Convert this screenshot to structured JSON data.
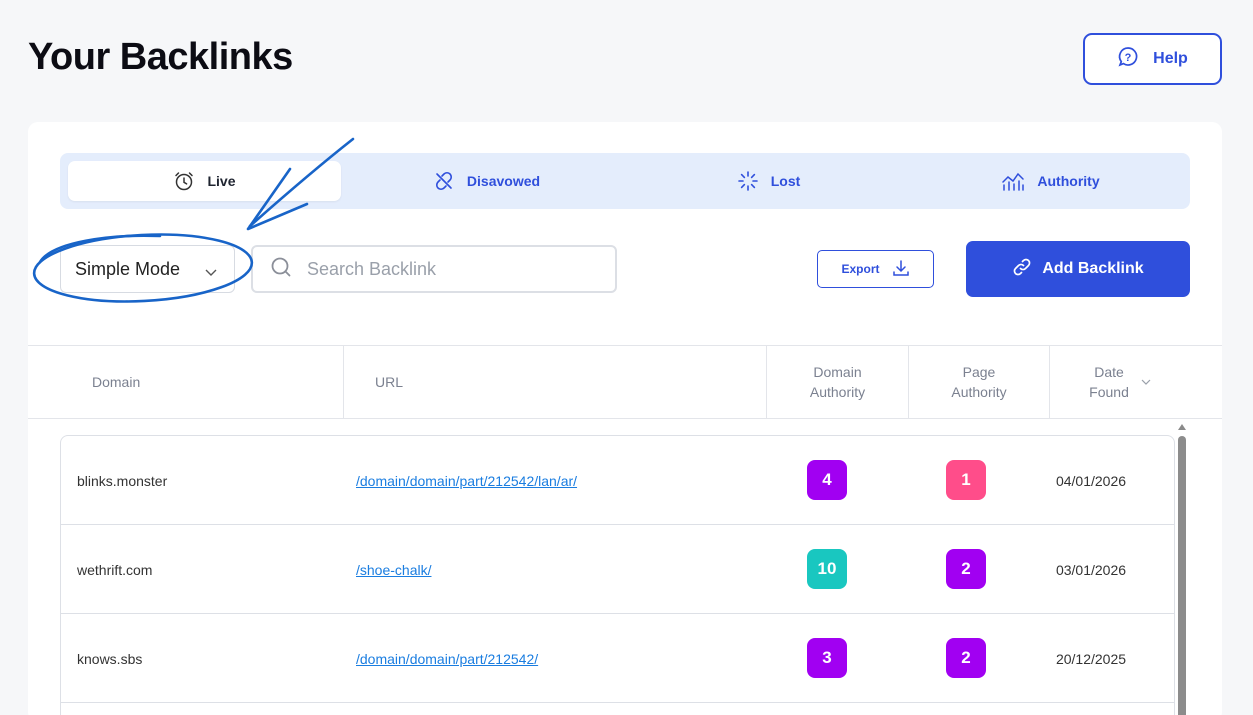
{
  "header": {
    "title": "Your Backlinks",
    "help_label": "Help"
  },
  "tabs": [
    {
      "label": "Live",
      "icon": "alarm-clock-icon",
      "active": true
    },
    {
      "label": "Disavowed",
      "icon": "broken-link-icon",
      "active": false
    },
    {
      "label": "Lost",
      "icon": "loading-spinner-icon",
      "active": false
    },
    {
      "label": "Authority",
      "icon": "chart-line-icon",
      "active": false
    }
  ],
  "toolbar": {
    "mode_value": "Simple Mode",
    "search_placeholder": "Search Backlink",
    "export_label": "Export",
    "add_label": "Add Backlink"
  },
  "table": {
    "columns": {
      "domain": "Domain",
      "url": "URL",
      "domain_authority": "Domain Authority",
      "page_authority": "Page Authority",
      "date_found": "Date Found"
    },
    "rows": [
      {
        "domain": "blinks.monster",
        "url": "/domain/domain/part/212542/lan/ar/",
        "da": "4",
        "pa": "1",
        "date": "04/01/2026",
        "da_color": "#a100f2",
        "pa_color": "#ff4d8a"
      },
      {
        "domain": "wethrift.com",
        "url": "/shoe-chalk/",
        "da": "10",
        "pa": "2",
        "date": "03/01/2026",
        "da_color": "#19c7c0",
        "pa_color": "#a100f2"
      },
      {
        "domain": "knows.sbs",
        "url": "/domain/domain/part/212542/",
        "da": "3",
        "pa": "2",
        "date": "20/12/2025",
        "da_color": "#a100f2",
        "pa_color": "#a100f2"
      }
    ]
  },
  "colors": {
    "accent": "#2f4fdc",
    "tab_bar": "#e4edfc",
    "annotation": "#1864c8"
  }
}
